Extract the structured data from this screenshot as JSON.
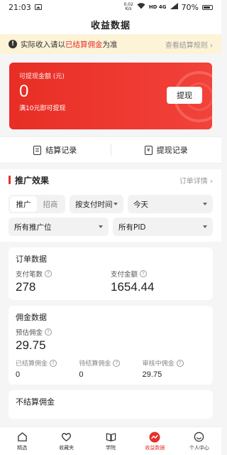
{
  "status": {
    "time": "21:03",
    "speed": "0.02\nK/s",
    "net": "HD 4G",
    "battery": "70%"
  },
  "page_title": "收益数据",
  "notice": {
    "text_before": "实际收入请以",
    "text_highlight": "已结算佣金",
    "text_after": "为准",
    "link": "查看结算规则 ›"
  },
  "balance": {
    "label": "可提现金额 (元)",
    "amount": "0",
    "min_note": "满10元即可提现",
    "withdraw_label": "提现"
  },
  "records": {
    "settle_label": "结算记录",
    "withdraw_label": "提现记录"
  },
  "promo": {
    "title": "推广效果",
    "detail_link": "订单详情 ›",
    "seg_promote": "推广",
    "seg_merchant": "招商",
    "time_mode": "按支付时间",
    "range": "今天",
    "position": "所有推广位",
    "pid": "所有PID"
  },
  "orders": {
    "title": "订单数据",
    "count_label": "支付笔数",
    "count_value": "278",
    "amount_label": "支付金额",
    "amount_value": "1654.44"
  },
  "commission": {
    "title": "佣金数据",
    "est_label": "预估佣金",
    "est_value": "29.75",
    "settled_label": "已结算佣金",
    "settled_value": "0",
    "pending_label": "待结算佣金",
    "pending_value": "0",
    "review_label": "审核中佣金",
    "review_value": "29.75"
  },
  "unsettled_title": "不结算佣金",
  "tabs": [
    {
      "label": "精选",
      "icon": "home-icon"
    },
    {
      "label": "收藏夹",
      "icon": "heart-icon"
    },
    {
      "label": "学院",
      "icon": "book-icon"
    },
    {
      "label": "收益数据",
      "icon": "earnings-icon"
    },
    {
      "label": "个人中心",
      "icon": "smile-icon"
    }
  ],
  "colors": {
    "accent": "#e5302c",
    "notice_bg": "#fdf3d7"
  }
}
